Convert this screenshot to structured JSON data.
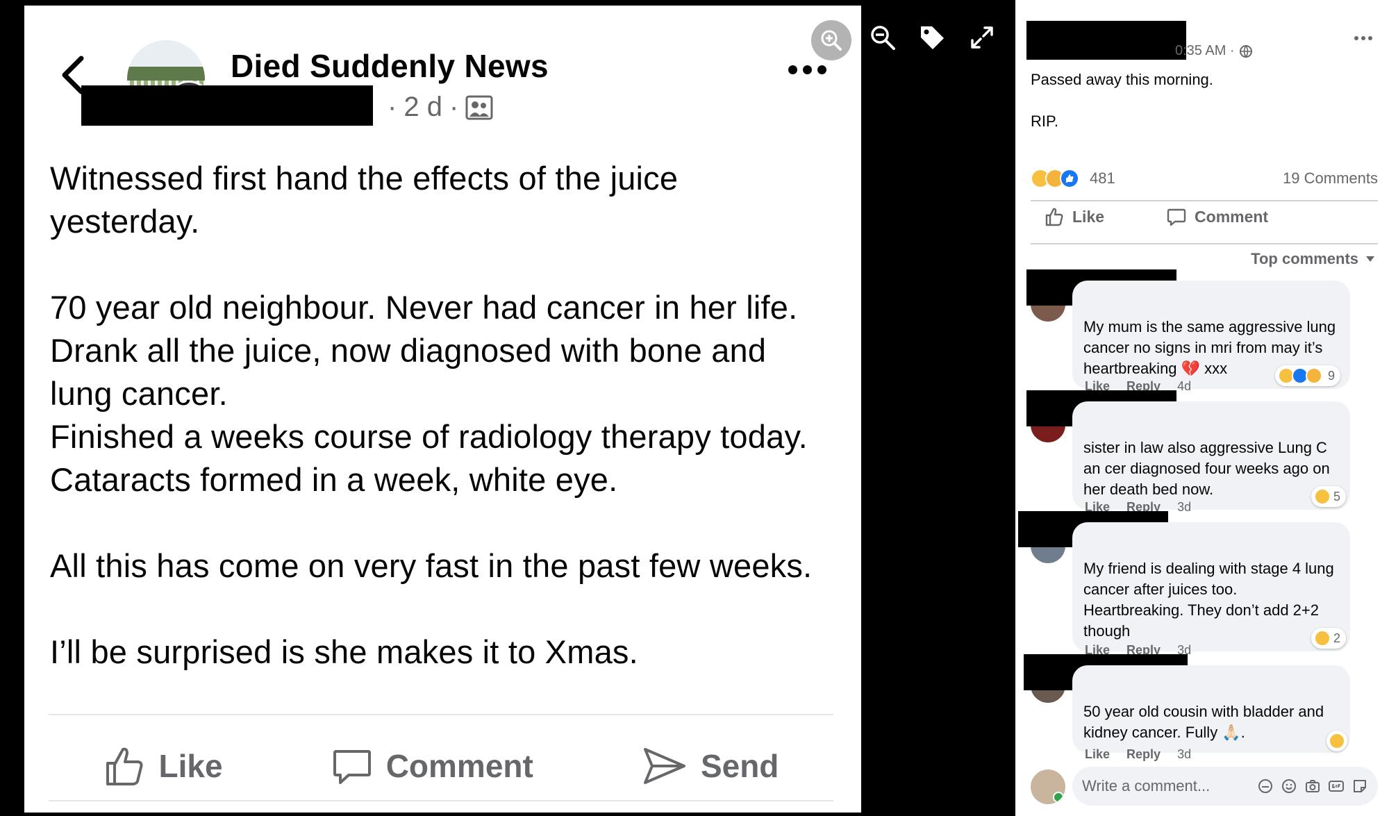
{
  "post": {
    "page_name": "Died Suddenly News",
    "age": "2 d",
    "text": "Witnessed first hand the effects of the juice\nyesterday.\n\n70 year old neighbour. Never had cancer in her life.\nDrank all the juice, now diagnosed with bone and\nlung cancer.\nFinished a weeks course of radiology therapy today.\nCataracts formed in a week, white eye.\n\nAll this has come on very fast in the past few weeks.\n\nI’ll be surprised is she makes it to Xmas.",
    "actions": {
      "like": "Like",
      "comment": "Comment",
      "send": "Send"
    }
  },
  "viewer_post": {
    "time": "0:35 AM ·",
    "text_line1": "Passed away this morning.",
    "text_line2": "RIP.",
    "reaction_count": "481",
    "comments_count": "19 Comments",
    "actions": {
      "like": "Like",
      "comment": "Comment"
    },
    "sort_label": "Top comments",
    "comments": [
      {
        "text": "My mum is the same aggressive lung cancer no signs in mri from may it’s heartbreaking 💔 xxx",
        "like": "Like",
        "reply": "Reply",
        "age": "4d",
        "reactions": "9"
      },
      {
        "text": "sister in law also aggressive Lung C an cer diagnosed four weeks ago on her death bed now.",
        "like": "Like",
        "reply": "Reply",
        "age": "3d",
        "reactions": "5"
      },
      {
        "text": "My friend is dealing with stage 4 lung cancer after juices too. Heartbreaking. They don’t add 2+2 though",
        "like": "Like",
        "reply": "Reply",
        "age": "3d",
        "reactions": "2"
      },
      {
        "text": "50 year old cousin with bladder and kidney cancer. Fully 🙏🏻.",
        "like": "Like",
        "reply": "Reply",
        "age": "3d",
        "reactions": ""
      }
    ],
    "write_placeholder": "Write a comment..."
  },
  "colors": {
    "brand_blue": "#1877f2",
    "secondary_text": "#65676b",
    "bubble_bg": "#f0f2f5"
  }
}
